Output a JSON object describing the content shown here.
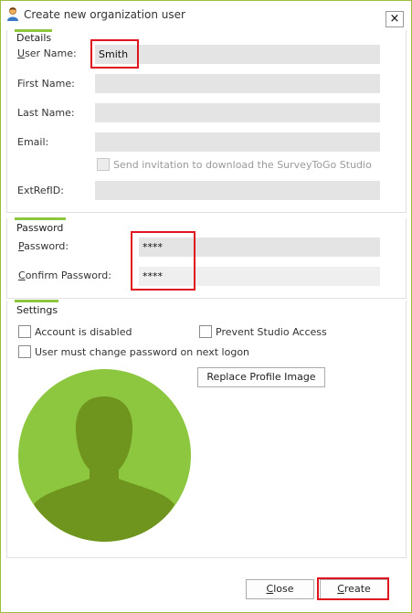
{
  "window": {
    "title": "Create new organization user",
    "close_symbol": "×"
  },
  "details": {
    "title": "Details",
    "user_name": {
      "label_mnemonic": "U",
      "label_rest": "ser Name:",
      "value": "Smith"
    },
    "first_name": {
      "label": "First Name:",
      "value": ""
    },
    "last_name": {
      "label": "Last Name:",
      "value": ""
    },
    "email": {
      "label": "Email:",
      "value": ""
    },
    "send_invitation": {
      "label": "Send invitation to download the SurveyToGo Studio",
      "checked": false,
      "enabled": false
    },
    "ext_ref_id": {
      "label": "ExtRefID:",
      "value": ""
    }
  },
  "password": {
    "title": "Password",
    "password": {
      "label_mnemonic": "P",
      "label_rest": "assword:",
      "value": "****"
    },
    "confirm": {
      "label_mnemonic": "C",
      "label_rest": "onfirm Password:",
      "value": "****"
    }
  },
  "settings": {
    "title": "Settings",
    "account_disabled": {
      "label": "Account is disabled",
      "checked": false
    },
    "prevent_studio": {
      "label": "Prevent Studio Access",
      "checked": false
    },
    "must_change_password": {
      "label": "User must change password on next logon",
      "checked": false
    },
    "replace_image_label": "Replace Profile Image"
  },
  "footer": {
    "close": {
      "mnemonic": "C",
      "rest": "lose"
    },
    "create": {
      "mnemonic": "C",
      "rest": "reate"
    }
  },
  "colors": {
    "accent": "#8dc63f",
    "highlight": "#e0141e",
    "avatar_bg": "#8dc63f",
    "avatar_figure": "#6f951f"
  }
}
